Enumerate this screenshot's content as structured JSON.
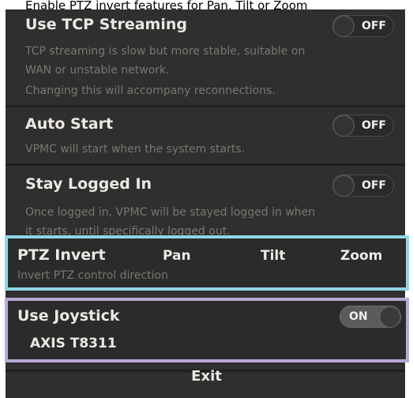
{
  "caption": "Enable PTZ invert features for Pan, Tilt or Zoom",
  "settings": {
    "tcp": {
      "title": "Use TCP Streaming",
      "toggle": "OFF",
      "desc1": "TCP streaming is slow but more stable, suitable on",
      "desc2": "WAN or unstable network.",
      "desc3": "Changing this will accompany reconnections."
    },
    "autostart": {
      "title": "Auto Start",
      "toggle": "OFF",
      "desc1": "VPMC will start when the system starts."
    },
    "stay": {
      "title": "Stay Logged In",
      "toggle": "OFF",
      "desc1": "Once logged in, VPMC will be stayed logged in when",
      "desc2": "it starts, until specifically logged out."
    },
    "ptz": {
      "title": "PTZ Invert",
      "desc": "Invert PTZ control direction",
      "options": [
        "Pan",
        "Tilt",
        "Zoom"
      ]
    },
    "joystick": {
      "title": "Use Joystick",
      "toggle": "ON",
      "device": "AXIS T8311"
    }
  },
  "exit_label": "Exit"
}
